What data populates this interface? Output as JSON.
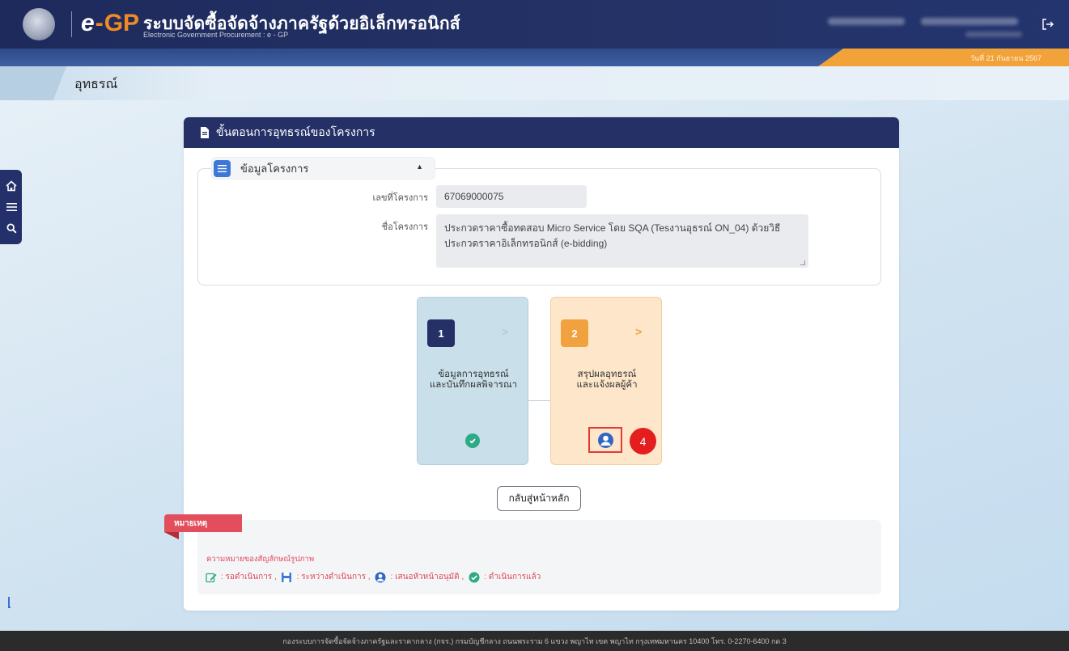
{
  "header": {
    "logo_e": "e",
    "logo_dash": "-",
    "logo_gp": "GP",
    "title": "ระบบจัดซื้อจัดจ้างภาครัฐด้วยอิเล็กทรอนิกส์",
    "subtitle": "Electronic Government Procurement : e - GP",
    "date": "วันที่ 21 กันยายน 2567",
    "logout_icon": "logout-icon"
  },
  "breadcrumb": {
    "title": "อุทธรณ์"
  },
  "side_menu": {
    "icons": [
      "home-icon",
      "menu-icon",
      "search-icon"
    ]
  },
  "card": {
    "title": "ขั้นตอนการอุทธรณ์ของโครงการ",
    "info_section": {
      "label": "ข้อมูลโครงการ",
      "project_no_label": "เลขที่โครงการ",
      "project_no": "67069000075",
      "project_name_label": "ชื่อโครงการ",
      "project_name": "ประกวดราคาซื้อทดสอบ Micro Service โดย SQA (Tesงานอุธรณ์ ON_04) ด้วยวิธีประกวดราคาอิเล็กทรอนิกส์ (e-bidding)"
    },
    "steps": [
      {
        "number": "1",
        "arrow": ">",
        "label_line1": "ข้อมูลการอุทธรณ์",
        "label_line2": "และบันทึกผลพิจารณา",
        "status": "check-icon"
      },
      {
        "number": "2",
        "arrow": ">",
        "label_line1": "สรุปผลอุทธรณ์",
        "label_line2": "และแจ้งผลผู้ค้า",
        "status": "user-icon"
      }
    ],
    "callout": "4",
    "back_button": "กลับสู่หน้าหลัก",
    "legend": {
      "tag": "หมายเหตุ",
      "title": "ความหมายของสัญลักษณ์รูปภาพ",
      "items": [
        {
          "icon": "edit-icon",
          "text": ": รอดำเนินการ ,"
        },
        {
          "icon": "save-icon",
          "text": ": ระหว่างดำเนินการ ,"
        },
        {
          "icon": "user-icon",
          "text": ": เสนอหัวหน้าอนุมัติ ,"
        },
        {
          "icon": "check-icon",
          "text": ": ดำเนินการแล้ว"
        }
      ]
    }
  },
  "footer": {
    "text": "กองระบบการจัดซื้อจัดจ้างภาครัฐและราคากลาง (กจร.) กรมบัญชีกลาง ถนนพระราม 6 แขวง พญาไท เขต พญาไท กรุงเทพมหานคร 10400 โทร. 0-2270-6400 กด 3"
  },
  "colors": {
    "navy": "#253067",
    "orange": "#f1a13e",
    "step1_bg": "#c9e0ea",
    "step2_bg": "#fde6c9",
    "callout_red": "#e41e1e",
    "legend_red": "#e04a5a"
  }
}
